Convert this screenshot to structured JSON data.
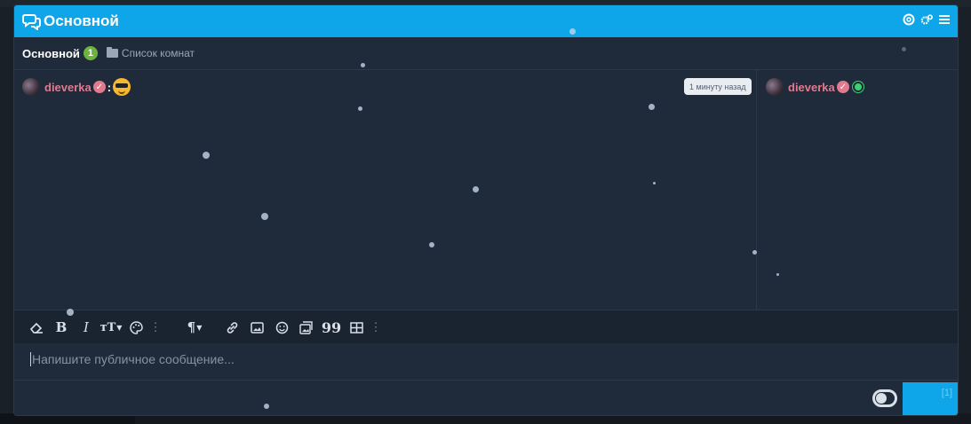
{
  "window": {
    "title": "Основной"
  },
  "tabs": {
    "active_label": "Основной",
    "active_badge": "1",
    "rooms_label": "Список комнат"
  },
  "message": {
    "username": "dieverka",
    "verified_mark": "✓",
    "separator": ":",
    "emoji_icon": "sunglasses-emoji-icon",
    "timestamp": "1 минуту назад"
  },
  "users": [
    {
      "username": "dieverka",
      "verified_mark": "✓",
      "status": "online"
    }
  ],
  "toolbar": {
    "icons": [
      "eraser-icon",
      "bold-icon",
      "italic-icon",
      "text-size-icon",
      "palette-icon",
      "more-icon",
      "paragraph-icon",
      "link-icon",
      "image-icon",
      "smiley-icon",
      "gallery-icon",
      "quote-icon",
      "table-icon",
      "more-icon"
    ],
    "bold_glyph": "B",
    "italic_glyph": "I",
    "size_glyph": "тT",
    "paragraph_glyph": "¶",
    "quote_glyph": "99",
    "more_glyph": "⋮"
  },
  "editor": {
    "placeholder": "Напишите публичное сообщение..."
  },
  "footer": {
    "send_counter": "[1]"
  },
  "colors": {
    "accent": "#0ea5e9",
    "panel_bg": "#1f2a3a",
    "username": "#e27a8f",
    "badge": "#6db33f",
    "online": "#3bd16f"
  }
}
